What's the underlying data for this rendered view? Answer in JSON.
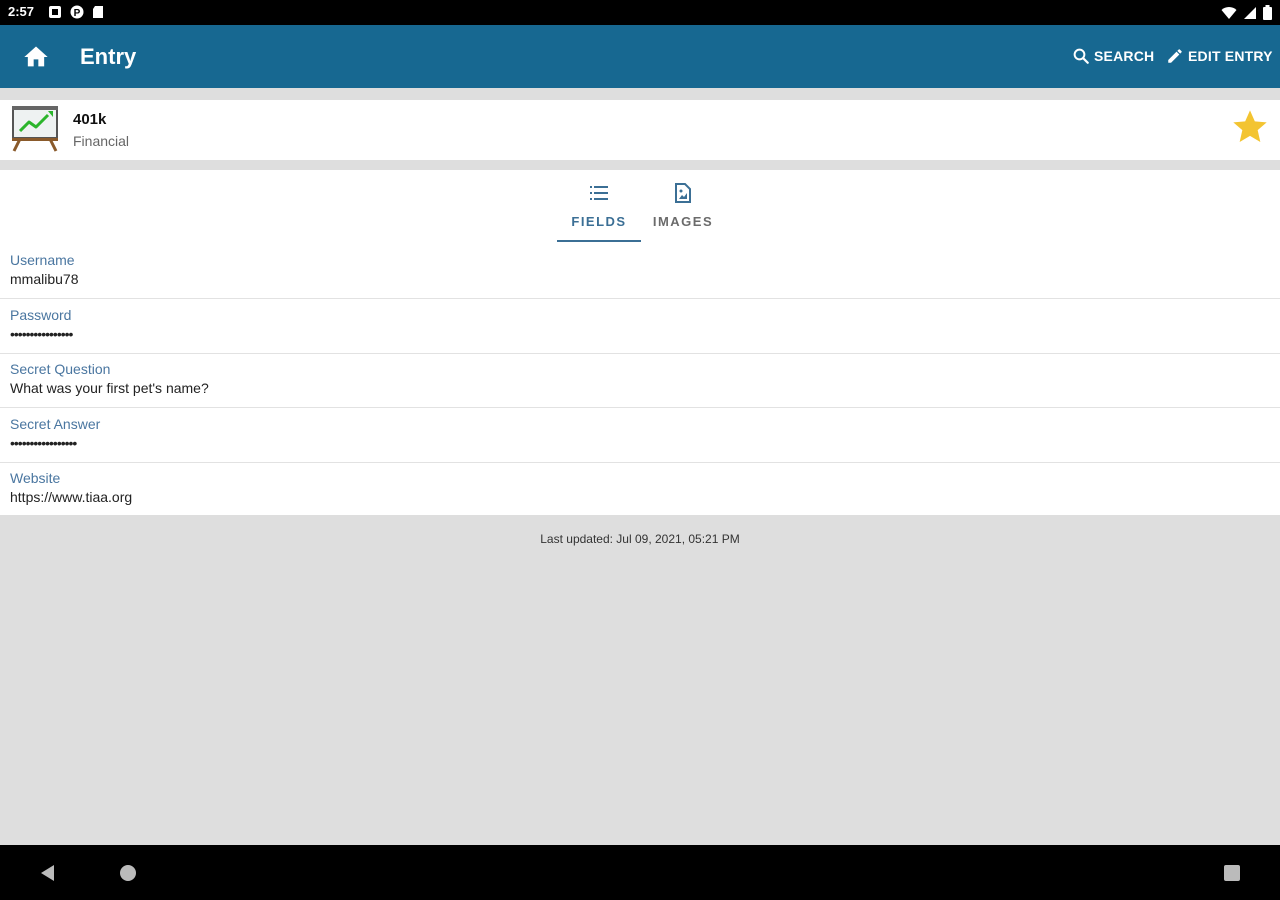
{
  "status_bar": {
    "time": "2:57"
  },
  "app_bar": {
    "title": "Entry",
    "search_label": "SEARCH",
    "edit_label": "EDIT ENTRY",
    "color": "#176891"
  },
  "entry": {
    "title": "401k",
    "category": "Financial",
    "favorite": true,
    "star_color": "#f3c431"
  },
  "tabs": [
    {
      "label": "FIELDS",
      "active": true
    },
    {
      "label": "IMAGES",
      "active": false
    }
  ],
  "fields": [
    {
      "label": "Username",
      "value": "mmalibu78"
    },
    {
      "label": "Password",
      "value": "••••••••••••••••"
    },
    {
      "label": "Secret Question",
      "value": "What was your first pet's name?"
    },
    {
      "label": "Secret Answer",
      "value": "•••••••••••••••••"
    },
    {
      "label": "Website",
      "value": "https://www.tiaa.org"
    }
  ],
  "last_updated": "Last updated: Jul 09, 2021, 05:21 PM"
}
